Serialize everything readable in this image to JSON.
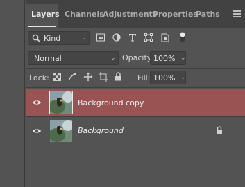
{
  "tabs": [
    {
      "label": "Layers"
    },
    {
      "label": "Channels"
    },
    {
      "label": "Adjustments"
    },
    {
      "label": "Properties"
    },
    {
      "label": "Paths"
    }
  ],
  "filter": {
    "kind_label": "Kind"
  },
  "blend": {
    "mode": "Normal",
    "opacity_label": "Opacity:",
    "opacity_value": "100%"
  },
  "lock": {
    "label": "Lock:",
    "fill_label": "Fill:",
    "fill_value": "100%"
  },
  "layers": [
    {
      "name": "Background copy",
      "selected": true,
      "visible": true
    },
    {
      "name": "Background",
      "selected": false,
      "visible": true,
      "locked": true
    }
  ],
  "colors": {
    "selected_row": "#9a5353",
    "panel_bg": "#535353",
    "tabbar_bg": "#424242"
  }
}
